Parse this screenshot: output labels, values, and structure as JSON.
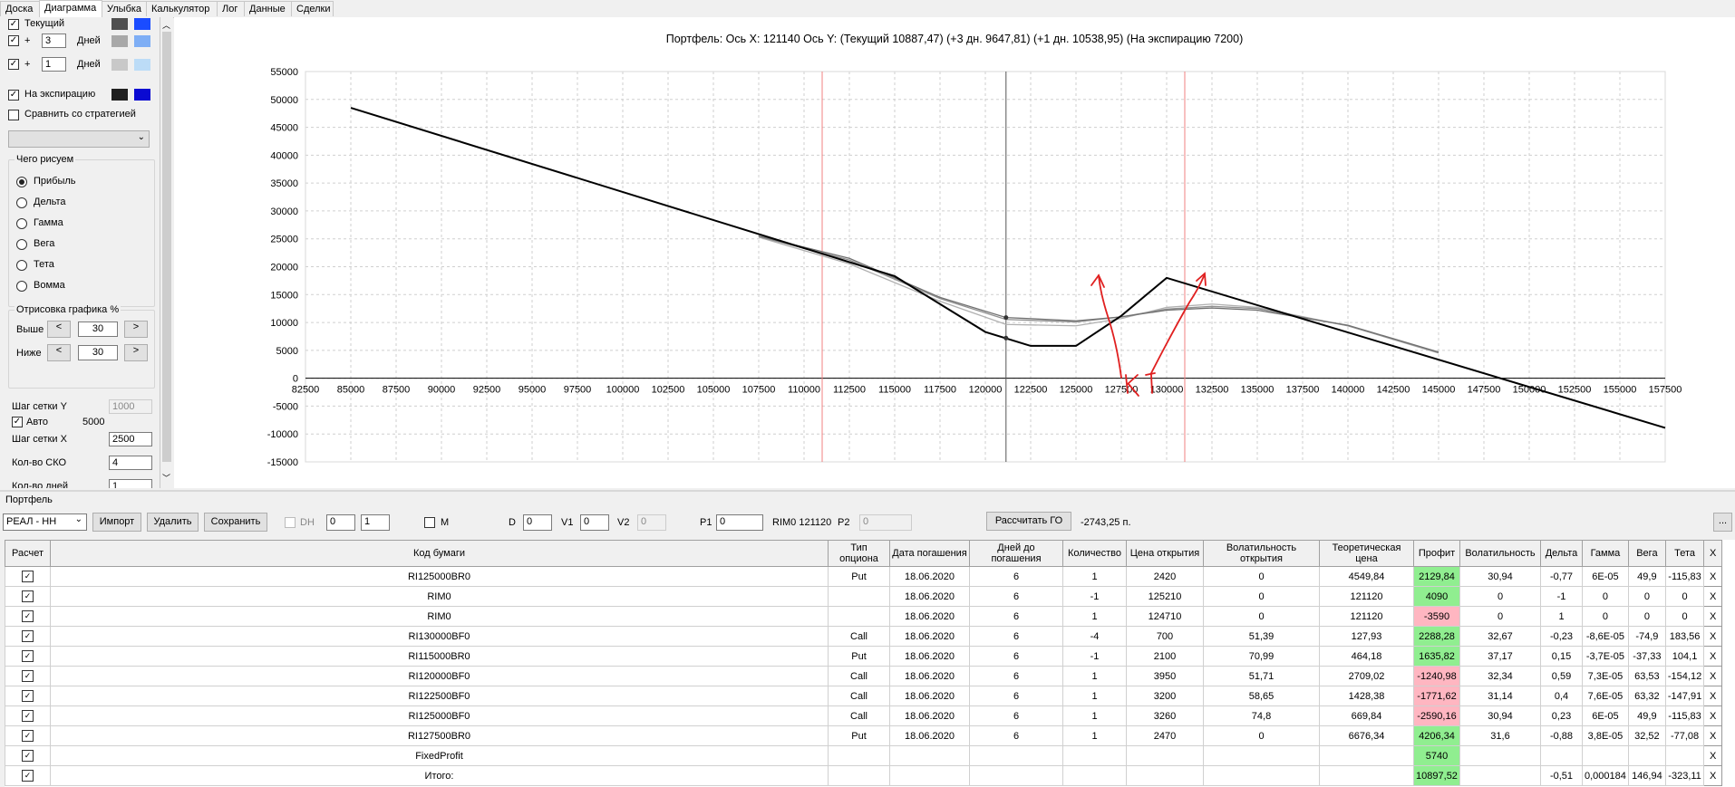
{
  "tabs": [
    "Доска",
    "Диаграмма",
    "Улыбка",
    "Калькулятор",
    "Лог",
    "Данные",
    "Сделки"
  ],
  "active_tab": 1,
  "left": {
    "current_label": "Текущий",
    "plus": "+",
    "days_label": "Дней",
    "plus_days_1": "3",
    "plus_days_2": "1",
    "expiry_label": "На экспирацию",
    "compare_label": "Сравнить со стратегией",
    "draw_group": "Чего рисуем",
    "options": [
      "Прибыль",
      "Дельта",
      "Гамма",
      "Вега",
      "Тета",
      "Вомма"
    ],
    "selected_option": 0,
    "render_group": "Отрисовка графика %",
    "above_label": "Выше",
    "below_label": "Ниже",
    "above_value": "30",
    "below_value": "30",
    "arrow_left": "<",
    "arrow_right": ">",
    "grid_y_label": "Шаг сетки Y",
    "grid_y_value": "1000",
    "auto_label": "Авто",
    "auto_value": "5000",
    "grid_x_label": "Шаг сетки X",
    "grid_x_value": "2500",
    "sko_label": "Кол-во СКО",
    "sko_value": "4",
    "days_count_label": "Кол-во дней",
    "days_count_value": "1",
    "colors": {
      "current": [
        "#505050",
        "#1a4cff"
      ],
      "plus3": [
        "#a8a8a8",
        "#7eaef5"
      ],
      "plus1": [
        "#c8c8c8",
        "#bcdcf7"
      ],
      "expiry": [
        "#202020",
        "#0a0ad2"
      ]
    }
  },
  "chart_data": {
    "type": "line",
    "title": "Портфель: Ось X: 121140 Ось Y:  (Текущий 10887,47)  (+3 дн. 9647,81)  (+1 дн. 10538,95)  (На экспирацию 7200)",
    "x_ticks": [
      82500,
      85000,
      87500,
      90000,
      92500,
      95000,
      97500,
      100000,
      102500,
      105000,
      107500,
      110000,
      112500,
      115000,
      117500,
      120000,
      122500,
      125000,
      127500,
      130000,
      132500,
      135000,
      137500,
      140000,
      142500,
      145000,
      147500,
      150000,
      152500,
      155000,
      157500
    ],
    "y_ticks": [
      55000,
      50000,
      45000,
      40000,
      35000,
      30000,
      25000,
      20000,
      15000,
      10000,
      5000,
      0,
      -5000,
      -10000,
      -15000
    ],
    "xlim": [
      82500,
      157500
    ],
    "ylim": [
      -15000,
      55000
    ],
    "grid": true,
    "cursor_x": 121140,
    "sd_lines": [
      111000,
      131000
    ],
    "series": [
      {
        "color": "#000000",
        "x": [
          85000,
          115000,
          120000,
          122500,
          125000,
          127500,
          130000,
          157500
        ],
        "y": [
          48500,
          18300,
          8300,
          5800,
          5800,
          11200,
          18000,
          -8900
        ]
      },
      {
        "color": "#707070",
        "x": [
          107500,
          112500,
          117500,
          121140,
          125000,
          127500,
          130000,
          132500,
          135000,
          140000,
          145000
        ],
        "y": [
          25500,
          21500,
          14500,
          10887,
          10300,
          11000,
          12200,
          12600,
          12200,
          9500,
          4700
        ]
      },
      {
        "color": "#b0b0b0",
        "x": [
          107500,
          112500,
          117500,
          121140,
          125000,
          127500,
          130000,
          132500,
          135000,
          140000,
          145000
        ],
        "y": [
          25300,
          20500,
          13800,
          9648,
          9400,
          10700,
          12700,
          13300,
          12700,
          9400,
          4500
        ]
      },
      {
        "color": "#909090",
        "x": [
          107500,
          112500,
          117500,
          121140,
          125000,
          127500,
          130000,
          132500,
          135000,
          140000,
          145000
        ],
        "y": [
          25400,
          21200,
          14300,
          10539,
          10100,
          11000,
          12400,
          12900,
          12500,
          9400,
          4600
        ]
      }
    ],
    "markers": [
      {
        "x": 121140,
        "y": 10887
      },
      {
        "x": 121140,
        "y": 7200
      }
    ]
  },
  "bottom": {
    "portfolio_label": "Портфель",
    "portfolio_select": "РЕАЛ - НН",
    "import_btn": "Импорт",
    "delete_btn": "Удалить",
    "save_btn": "Сохранить",
    "dh_label": "DH",
    "dh_v1": "0",
    "dh_v2": "1",
    "m_label": "M",
    "d_label": "D",
    "d_value": "0",
    "v1_label": "V1",
    "v1_value": "0",
    "v2_label": "V2",
    "v2_value": "0",
    "p1_label": "P1",
    "p1_value": "0",
    "rim_label": "RIM0 121120",
    "p2_label": "P2",
    "p2_value": "0",
    "go_btn": "Рассчитать ГО",
    "go_value": "-2743,25 п.",
    "more_btn": "..."
  },
  "table": {
    "headers": [
      "Расчет",
      "Код бумаги",
      "Тип опциона",
      "Дата погашения",
      "Дней до погашения",
      "Количество",
      "Цена открытия",
      "Волатильность открытия",
      "Теоретическая цена",
      "Профит",
      "Волатильность",
      "Дельта",
      "Гамма",
      "Вега",
      "Тета",
      "X"
    ],
    "rows": [
      [
        "RI125000BR0",
        "Put",
        "18.06.2020",
        "6",
        "1",
        "2420",
        "0",
        "4549,84",
        "2129,84",
        "30,94",
        "-0,77",
        "6E-05",
        "49,9",
        "-115,83"
      ],
      [
        "RIM0",
        "",
        "18.06.2020",
        "6",
        "-1",
        "125210",
        "0",
        "121120",
        "4090",
        "0",
        "-1",
        "0",
        "0",
        "0"
      ],
      [
        "RIM0",
        "",
        "18.06.2020",
        "6",
        "1",
        "124710",
        "0",
        "121120",
        "-3590",
        "0",
        "1",
        "0",
        "0",
        "0"
      ],
      [
        "RI130000BF0",
        "Call",
        "18.06.2020",
        "6",
        "-4",
        "700",
        "51,39",
        "127,93",
        "2288,28",
        "32,67",
        "-0,23",
        "-8,6E-05",
        "-74,9",
        "183,56"
      ],
      [
        "RI115000BR0",
        "Put",
        "18.06.2020",
        "6",
        "-1",
        "2100",
        "70,99",
        "464,18",
        "1635,82",
        "37,17",
        "0,15",
        "-3,7E-05",
        "-37,33",
        "104,1"
      ],
      [
        "RI120000BF0",
        "Call",
        "18.06.2020",
        "6",
        "1",
        "3950",
        "51,71",
        "2709,02",
        "-1240,98",
        "32,34",
        "0,59",
        "7,3E-05",
        "63,53",
        "-154,12"
      ],
      [
        "RI122500BF0",
        "Call",
        "18.06.2020",
        "6",
        "1",
        "3200",
        "58,65",
        "1428,38",
        "-1771,62",
        "31,14",
        "0,4",
        "7,6E-05",
        "63,32",
        "-147,91"
      ],
      [
        "RI125000BF0",
        "Call",
        "18.06.2020",
        "6",
        "1",
        "3260",
        "74,8",
        "669,84",
        "-2590,16",
        "30,94",
        "0,23",
        "6E-05",
        "49,9",
        "-115,83"
      ],
      [
        "RI127500BR0",
        "Put",
        "18.06.2020",
        "6",
        "1",
        "2470",
        "0",
        "6676,34",
        "4206,34",
        "31,6",
        "-0,88",
        "3,8E-05",
        "32,52",
        "-77,08"
      ],
      [
        "FixedProfit",
        "",
        "",
        "",
        "",
        "",
        "",
        "",
        "5740",
        "",
        "",
        "",
        "",
        ""
      ],
      [
        "Итого:",
        "",
        "",
        "",
        "",
        "",
        "",
        "",
        "10897,52",
        "",
        "-0,51",
        "0,000184",
        "146,94",
        "-323,11"
      ]
    ]
  }
}
